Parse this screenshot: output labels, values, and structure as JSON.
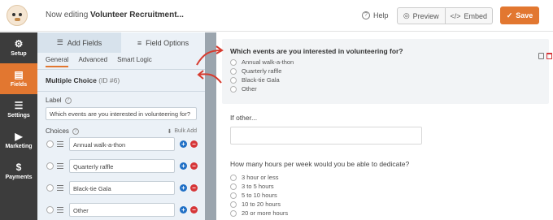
{
  "header": {
    "editing_prefix": "Now editing",
    "form_name": "Volunteer Recruitment...",
    "help_label": "Help",
    "preview_label": "Preview",
    "embed_label": "Embed",
    "save_label": "Save",
    "accent_color": "#e27730"
  },
  "nav": {
    "items": [
      {
        "label": "Setup",
        "icon": "gear-icon"
      },
      {
        "label": "Fields",
        "icon": "fields-icon"
      },
      {
        "label": "Settings",
        "icon": "sliders-icon"
      },
      {
        "label": "Marketing",
        "icon": "megaphone-icon"
      },
      {
        "label": "Payments",
        "icon": "dollar-icon"
      }
    ],
    "active": "Fields"
  },
  "panel": {
    "tabs": [
      "Add Fields",
      "Field Options"
    ],
    "subtabs": [
      "General",
      "Advanced",
      "Smart Logic"
    ],
    "field_type": "Multiple Choice",
    "field_id": "(ID #6)",
    "label_title": "Label",
    "label_value": "Which events are you interested in volunteering for?",
    "choices_title": "Choices",
    "bulk_add": "Bulk Add",
    "choices": [
      "Annual walk-a-thon",
      "Quarterly raffle",
      "Black-tie Gala",
      "Other"
    ]
  },
  "preview": {
    "q1": {
      "title": "Which events are you interested in volunteering for?",
      "options": [
        "Annual walk-a-thon",
        "Quarterly raffle",
        "Black-tie Gala",
        "Other"
      ]
    },
    "q2": {
      "title": "If other..."
    },
    "q3": {
      "title": "How many hours per week would you be able to dedicate?",
      "options": [
        "3 hour or less",
        "3 to 5 hours",
        "5 to 10 hours",
        "10 to 20 hours",
        "20 or more hours"
      ]
    }
  }
}
